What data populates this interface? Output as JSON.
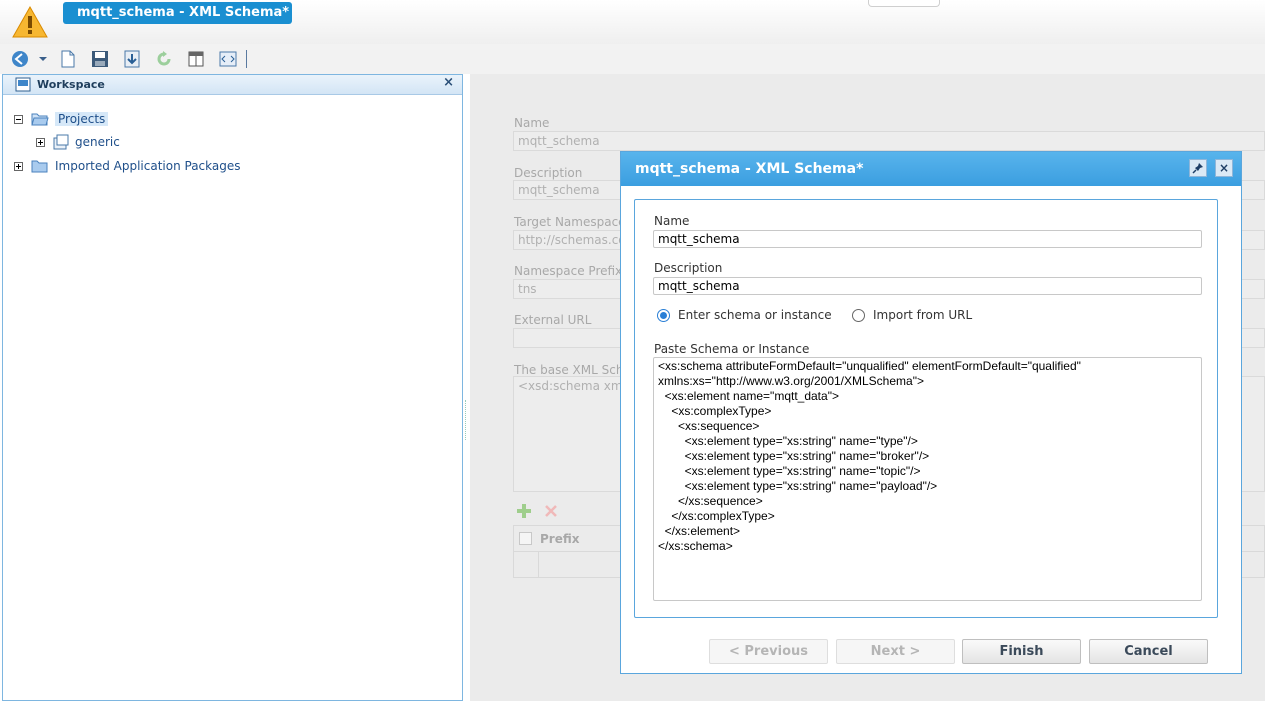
{
  "header": {
    "title": "mqtt_schema - XML Schema*"
  },
  "toolbar": {
    "icons": [
      "back-icon",
      "new-document-icon",
      "save-icon",
      "deploy-icon",
      "refresh-icon",
      "table-icon",
      "xml-view-icon"
    ]
  },
  "workspace": {
    "title": "Workspace",
    "close_label": "×",
    "tree": {
      "projects_label": "Projects",
      "generic_label": "generic",
      "imported_label": "Imported Application Packages"
    }
  },
  "background_form": {
    "name_label": "Name",
    "name_value": "mqtt_schema",
    "description_label": "Description",
    "description_value": "mqtt_schema",
    "target_ns_label": "Target Namespace",
    "target_ns_value": "http://schemas.corc",
    "ns_prefix_label": "Namespace Prefix ir",
    "ns_prefix_value": "tns",
    "external_url_label": "External URL",
    "base_xml_label": "The base XML Sche",
    "base_xml_value": "<xsd:schema xmlr",
    "grid_prefix_header": "Prefix"
  },
  "modal": {
    "title": "mqtt_schema - XML Schema*",
    "pin_label": "⇲",
    "close_label": "×",
    "name_label": "Name",
    "name_value": "mqtt_schema",
    "description_label": "Description",
    "description_value": "mqtt_schema",
    "radio_enter_label": "Enter schema or instance",
    "radio_import_label": "Import from URL",
    "selected_radio": "enter",
    "paste_label": "Paste Schema or Instance",
    "schema_text": "<xs:schema attributeFormDefault=\"unqualified\" elementFormDefault=\"qualified\"\nxmlns:xs=\"http://www.w3.org/2001/XMLSchema\">\n  <xs:element name=\"mqtt_data\">\n    <xs:complexType>\n      <xs:sequence>\n        <xs:element type=\"xs:string\" name=\"type\"/>\n        <xs:element type=\"xs:string\" name=\"broker\"/>\n        <xs:element type=\"xs:string\" name=\"topic\"/>\n        <xs:element type=\"xs:string\" name=\"payload\"/>\n      </xs:sequence>\n    </xs:complexType>\n  </xs:element>\n</xs:schema>",
    "buttons": {
      "previous": "< Previous",
      "next": "Next >",
      "finish": "Finish",
      "cancel": "Cancel"
    }
  },
  "colors": {
    "accent": "#3b9ee0",
    "title_tab": "#1a8fd1"
  }
}
